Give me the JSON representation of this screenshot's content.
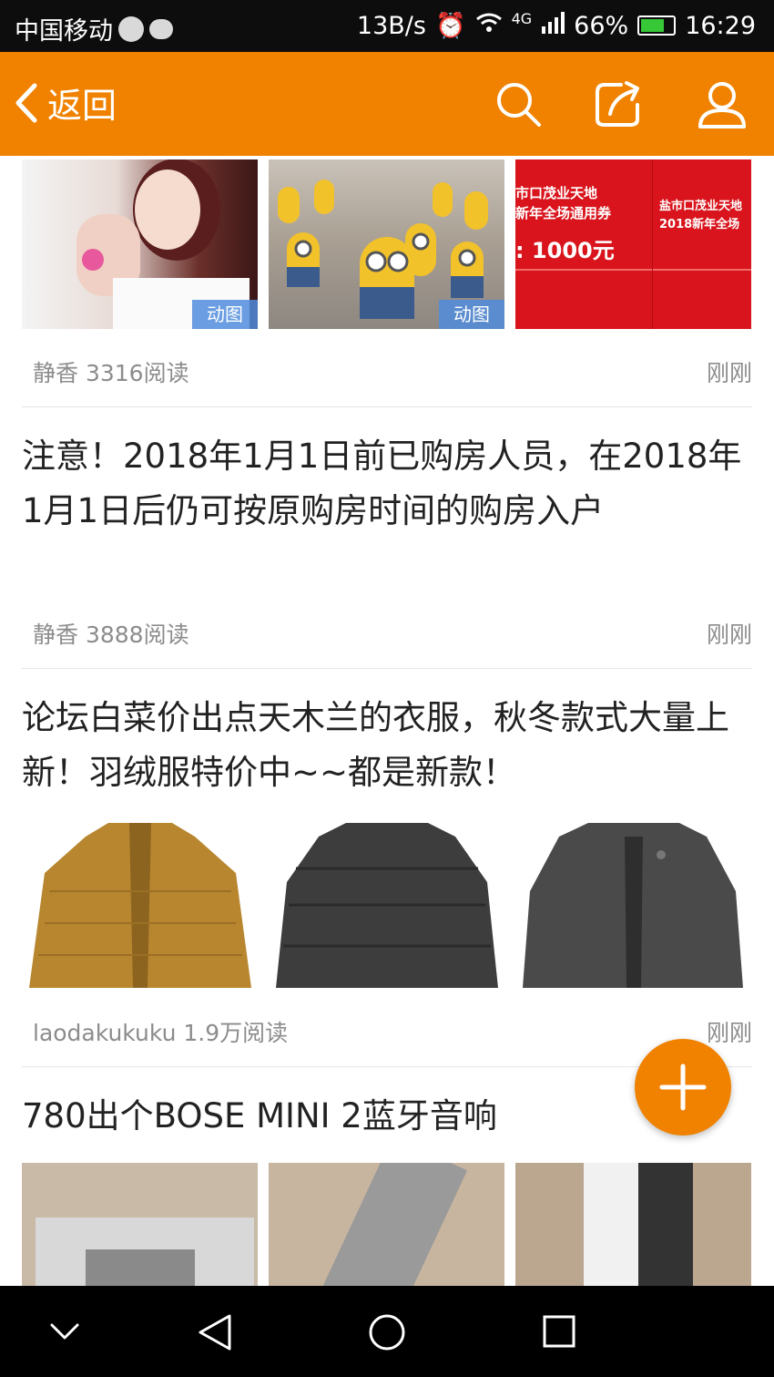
{
  "status_bar": {
    "carrier": "中国移动",
    "speed": "13B/s",
    "signal": "4G",
    "battery": "66%",
    "time": "16:29"
  },
  "nav": {
    "back_label": "返回",
    "icons": [
      "search-icon",
      "share-icon",
      "profile-icon"
    ]
  },
  "posts": [
    {
      "images": [
        {
          "desc": "girl photo",
          "tag": "动图"
        },
        {
          "desc": "minions",
          "tag": "动图"
        },
        {
          "desc": "red coupon",
          "tag": ""
        }
      ],
      "meta": "静香 3316阅读",
      "time": "刚刚"
    },
    {
      "title": "注意！2018年1月1日前已购房人员，在2018年1月1日后仍可按原购房时间的购房入户",
      "meta": "静香 3888阅读",
      "time": "刚刚"
    },
    {
      "title": "论坛白菜价出点天木兰的衣服，秋冬款式大量上新！羽绒服特价中~~都是新款！",
      "meta": "laodakukuku 1.9万阅读",
      "time": "刚刚"
    },
    {
      "title": "780出个BOSE MINI 2蓝牙音响"
    }
  ],
  "coupon": {
    "line1": "市口茂业天地",
    "line2": "新年全场通用券",
    "value": ": 1000元",
    "right1": "盐市口茂业天地",
    "right2": "2018新年全场"
  },
  "colors": {
    "accent": "#f08200",
    "status_bar": "#0d0d0d",
    "meta_text": "#8c8c8c"
  }
}
